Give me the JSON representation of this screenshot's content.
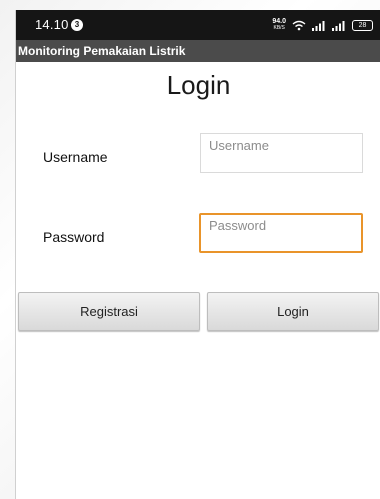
{
  "status_bar": {
    "time": "14.10",
    "notification_count": "3",
    "network_speed": "94.0",
    "network_speed_unit": "KB/S",
    "battery": "28",
    "icons": [
      "notification-badge",
      "wifi-icon",
      "signal-icon",
      "signal-icon",
      "battery-icon"
    ]
  },
  "app_bar": {
    "title": "Monitoring Pemakaian Listrik"
  },
  "form": {
    "title": "Login",
    "username_label": "Username",
    "username_placeholder": "Username",
    "username_value": "",
    "password_label": "Password",
    "password_placeholder": "Password",
    "password_value": "",
    "focused_field": "password"
  },
  "buttons": {
    "register_label": "Registrasi",
    "login_label": "Login"
  },
  "colors": {
    "status_bar_bg": "#151515",
    "app_bar_bg": "#4b4b4b",
    "focus_border": "#e9942a",
    "button_bg": "#e3e3e3"
  }
}
